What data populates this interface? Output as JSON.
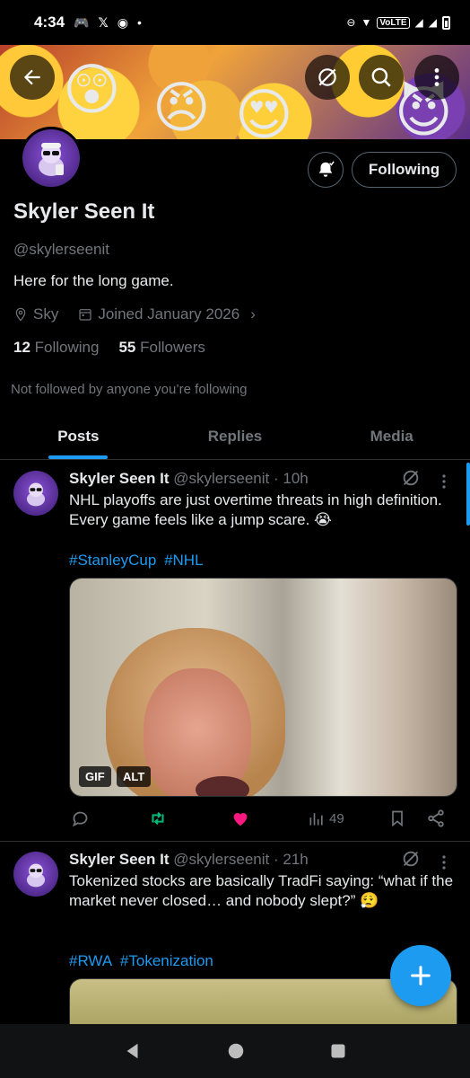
{
  "status_bar": {
    "time": "4:34",
    "network": "VoLTE"
  },
  "profile": {
    "name": "Skyler Seen It",
    "handle": "@skylerseenit",
    "bio": "Here for the long game.",
    "location": "Sky",
    "joined": "Joined January 2026",
    "following_count": "12",
    "following_label": "Following",
    "followers_count": "55",
    "followers_label": "Followers",
    "not_followed_text": "Not followed by anyone you’re following",
    "follow_button": "Following"
  },
  "tabs": [
    {
      "label": "Posts",
      "active": true
    },
    {
      "label": "Replies",
      "active": false
    },
    {
      "label": "Media",
      "active": false
    }
  ],
  "posts": [
    {
      "author": "Skyler Seen It",
      "handle": "@skylerseenit",
      "time": "· 10h",
      "text": "NHL playoffs are just overtime threats in high definition. Every game feels like a jump scare. 😭",
      "hashtags": [
        "#StanleyCup",
        "#NHL"
      ],
      "media_badges": [
        "GIF",
        "ALT"
      ],
      "views": "49"
    },
    {
      "author": "Skyler Seen It",
      "handle": "@skylerseenit",
      "time": "· 21h",
      "text": "Tokenized stocks are basically TradFi saying: “what if the market never closed… and nobody slept?” 😮‍💨",
      "hashtags": [
        "#RWA",
        "#Tokenization"
      ]
    }
  ],
  "colors": {
    "accent": "#1d9bf0",
    "retweet": "#00ba7c",
    "like": "#f91880"
  },
  "icons": [
    "back-arrow-icon",
    "grok-icon",
    "search-icon",
    "more-vertical-icon",
    "bell-icon",
    "location-icon",
    "calendar-icon",
    "reply-icon",
    "retweet-icon",
    "heart-icon",
    "views-icon",
    "bookmark-icon",
    "share-icon",
    "plus-icon"
  ]
}
